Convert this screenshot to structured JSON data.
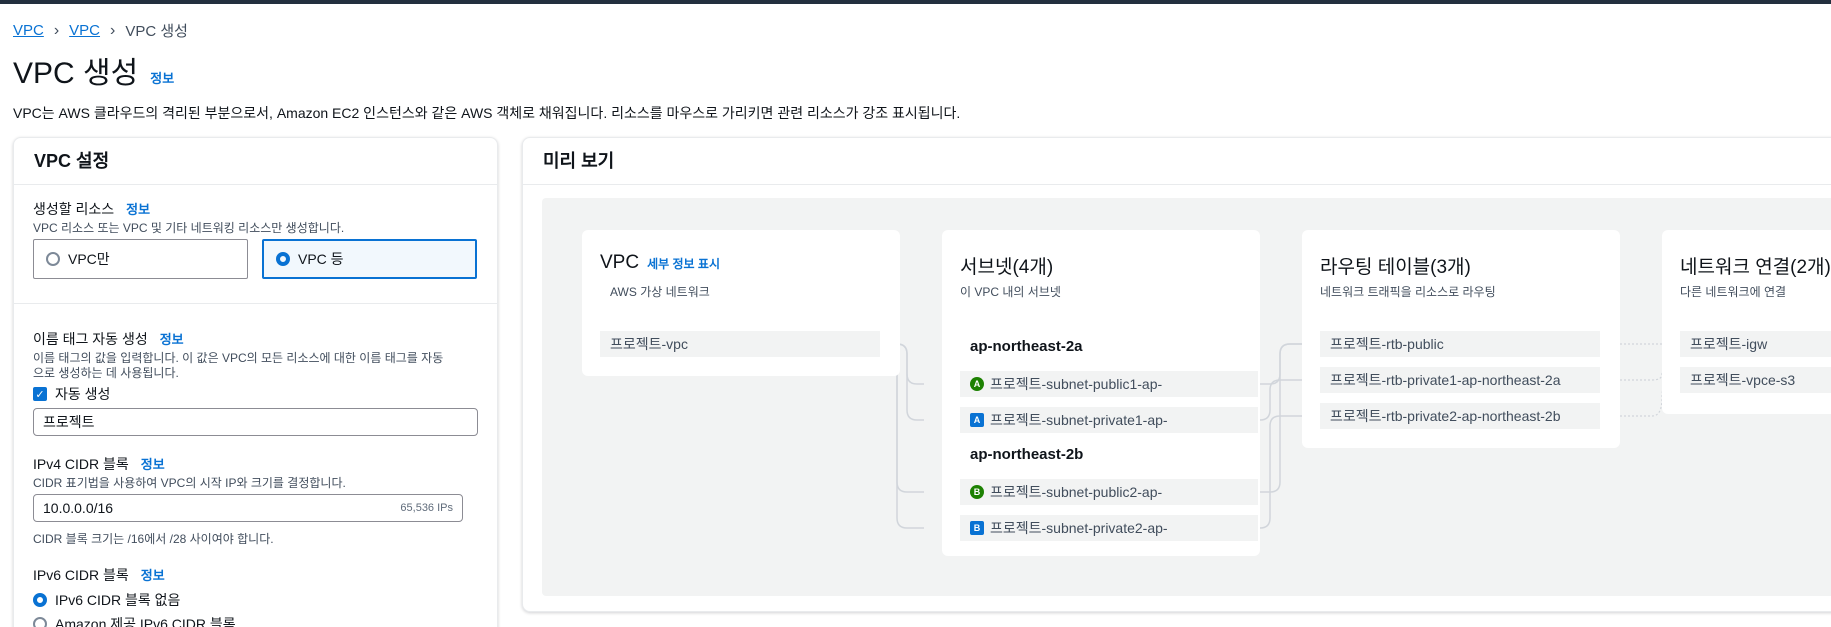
{
  "breadcrumb": {
    "items": [
      "VPC",
      "VPC"
    ],
    "current": "VPC 생성"
  },
  "page": {
    "title": "VPC 생성",
    "info": "정보",
    "description": "VPC는 AWS 클라우드의 격리된 부분으로서, Amazon EC2 인스턴스와 같은 AWS 객체로 채워집니다. 리소스를 마우스로 가리키면 관련 리소스가 강조 표시됩니다."
  },
  "settings": {
    "header": "VPC 설정",
    "resources": {
      "label": "생성할 리소스",
      "info": "정보",
      "hint": "VPC 리소스 또는 VPC 및 기타 네트워킹 리소스만 생성합니다.",
      "options": [
        "VPC만",
        "VPC 등"
      ],
      "selected": "VPC 등"
    },
    "name_tag": {
      "label": "이름 태그 자동 생성",
      "info": "정보",
      "hint_line1": "이름 태그의 값을 입력합니다. 이 값은 VPC의 모든 리소스에 대한 이름 태그를 자동",
      "hint_line2": "으로 생성하는 데 사용됩니다.",
      "checkbox_label": "자동 생성",
      "value": "프로젝트"
    },
    "ipv4": {
      "label": "IPv4 CIDR 블록",
      "info": "정보",
      "hint": "CIDR 표기법을 사용하여 VPC의 시작 IP와 크기를 결정합니다.",
      "value": "10.0.0.0/16",
      "ips": "65,536 IPs",
      "constraint": "CIDR 블록 크기는 /16에서 /28 사이여야 합니다."
    },
    "ipv6": {
      "label": "IPv6 CIDR 블록",
      "info": "정보",
      "options": [
        "IPv6 CIDR 블록 없음",
        "Amazon 제공 IPv6 CIDR 블록"
      ],
      "selected": "IPv6 CIDR 블록 없음"
    }
  },
  "preview": {
    "header": "미리 보기",
    "vpc": {
      "title": "VPC",
      "link": "세부 정보 표시",
      "subtitle": "AWS 가상 네트워크",
      "item": "프로젝트-vpc"
    },
    "subnets": {
      "title": "서브넷(4개)",
      "subtitle": "이 VPC 내의 서브넷",
      "zones": [
        {
          "name": "ap-northeast-2a",
          "items": [
            {
              "badge": "A",
              "label": "프로젝트-subnet-public1-ap-"
            },
            {
              "badge": "A",
              "label": "프로젝트-subnet-private1-ap-"
            }
          ]
        },
        {
          "name": "ap-northeast-2b",
          "items": [
            {
              "badge": "B",
              "label": "프로젝트-subnet-public2-ap-"
            },
            {
              "badge": "B",
              "label": "프로젝트-subnet-private2-ap-"
            }
          ]
        }
      ]
    },
    "routes": {
      "title": "라우팅 테이블(3개)",
      "subtitle": "네트워크 트래픽을 리소스로 라우팅",
      "items": [
        "프로젝트-rtb-public",
        "프로젝트-rtb-private1-ap-northeast-2a",
        "프로젝트-rtb-private2-ap-northeast-2b"
      ]
    },
    "connections": {
      "title": "네트워크 연결(2개)",
      "subtitle": "다른 네트워크에 연결",
      "items": [
        "프로젝트-igw",
        "프로젝트-vpce-s3"
      ]
    }
  },
  "colors": {
    "link": "#0972d3",
    "public_badge": "#1d8102",
    "private_badge": "#0972d3"
  }
}
